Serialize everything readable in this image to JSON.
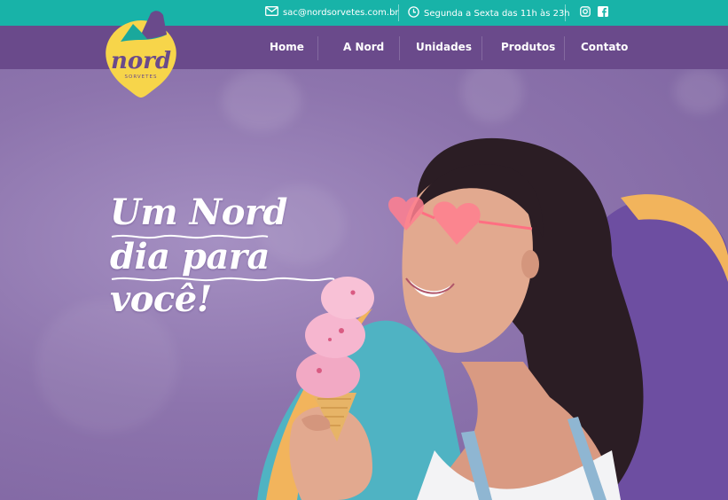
{
  "topbar": {
    "email": "sac@nordsorvetes.com.br",
    "hours": "Segunda a Sexta das 11h às 23h",
    "icons": [
      "mail-icon",
      "clock-icon",
      "instagram-icon",
      "facebook-icon"
    ]
  },
  "brand": {
    "name": "nord",
    "tagline": "SORVETES"
  },
  "nav": {
    "items": [
      {
        "label": "Home"
      },
      {
        "label": "A Nord"
      },
      {
        "label": "Unidades"
      },
      {
        "label": "Produtos"
      },
      {
        "label": "Contato"
      }
    ]
  },
  "hero": {
    "headline_line1": "Um Nord",
    "headline_line2": "dia para você!"
  },
  "colors": {
    "topbar": "#18b3a8",
    "navbar": "#6a4a8b",
    "logo_yellow": "#f7d54a",
    "accent_orange": "#f2b45c",
    "hero_purple": "#8d74ad",
    "teal_shape": "#4fb3c3"
  }
}
